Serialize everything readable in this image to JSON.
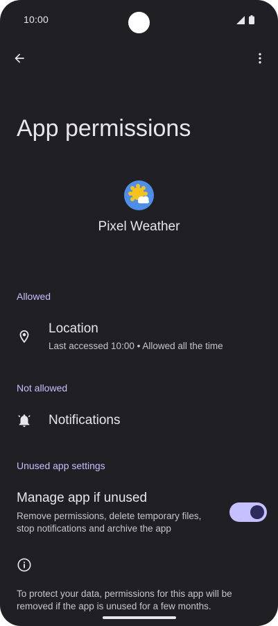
{
  "status_bar": {
    "time": "10:00"
  },
  "app_bar": {
    "back_icon": "arrow-back-icon",
    "more_icon": "more-vert-icon"
  },
  "page": {
    "title": "App permissions"
  },
  "app": {
    "name": "Pixel Weather",
    "icon": "weather-sun-cloud-icon"
  },
  "sections": {
    "allowed": {
      "header": "Allowed",
      "items": [
        {
          "icon": "location-pin-icon",
          "title": "Location",
          "summary": "Last accessed 10:00 • Allowed all the time"
        }
      ]
    },
    "not_allowed": {
      "header": "Not allowed",
      "items": [
        {
          "icon": "notifications-bell-icon",
          "title": "Notifications"
        }
      ]
    },
    "unused": {
      "header": "Unused app settings",
      "manage_title": "Manage app if unused",
      "manage_summary": "Remove permissions, delete temporary files, stop notifications and archive the app",
      "toggle_on": true
    }
  },
  "footer": {
    "icon": "info-icon",
    "text": "To protect your data, permissions for this app will be removed if the app is unused for a few months."
  },
  "colors": {
    "background": "#1f1f24",
    "accent": "#c5c0ff",
    "text_primary": "#e8e6ea",
    "text_secondary": "#c9c5cc"
  }
}
